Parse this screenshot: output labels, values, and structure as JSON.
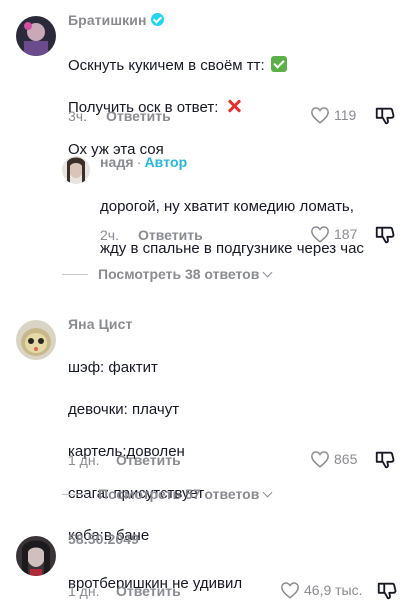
{
  "comments": [
    {
      "username": "Братишкин",
      "lines": [
        "Оскнуть кукичем в своём тт:",
        "Получить оск в ответ:",
        "Ох уж эта соя"
      ],
      "time": "3ч.",
      "reply_label": "Ответить",
      "likes": "119",
      "verified": true
    },
    {
      "username": "надя",
      "author_label": "Автор",
      "lines": [
        "дорогой, ну хватит комедию ломать,",
        "жду в спальне в подгузнике через час"
      ],
      "time": "2ч.",
      "reply_label": "Ответить",
      "likes": "187"
    },
    {
      "username": "Яна Цист",
      "lines": [
        "шэф: фактит",
        "девочки: плачут",
        "картель:доволен",
        "свага: присутствует",
        "коба:в бане"
      ],
      "time": "1 дн.",
      "reply_label": "Ответить",
      "likes": "865"
    },
    {
      "username": "58.50.2049",
      "lines": [
        "вротберишкин не удивил"
      ],
      "time": "1 дн.",
      "reply_label": "Ответить",
      "likes": "46,9 тыс."
    }
  ],
  "view_replies": [
    "Посмотреть 38 ответов",
    "Посмотреть 57 ответов"
  ],
  "colors": {
    "secondary_text": "#8a8b91",
    "author_accent": "#2bb5d6",
    "verified_badge": "#20d5ec"
  },
  "icons": [
    "heart-outline-icon",
    "dislike-icon",
    "verified-badge-icon",
    "chevron-down-icon",
    "check-emoji-icon",
    "cross-emoji-icon"
  ]
}
